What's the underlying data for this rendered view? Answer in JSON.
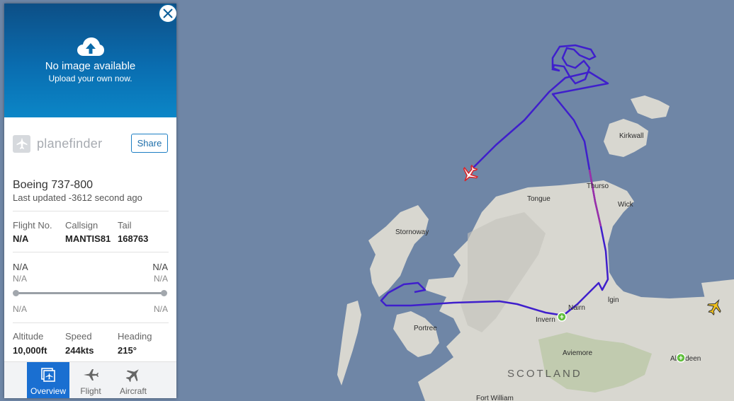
{
  "panel": {
    "photo": {
      "title": "No image available",
      "subtitle": "Upload your own now.",
      "icon": "upload-cloud-icon"
    },
    "close_icon": "close-icon",
    "brand": "planefinder",
    "share_label": "Share",
    "aircraft_type": "Boeing 737-800",
    "last_updated": "Last updated -3612 second ago",
    "flight_labels": {
      "flight_no": "Flight No.",
      "callsign": "Callsign",
      "tail": "Tail"
    },
    "flight_values": {
      "flight_no": "N/A",
      "callsign": "MANTIS81",
      "tail": "168763"
    },
    "route": {
      "origin": "N/A",
      "origin_sub": "N/A",
      "destination": "N/A",
      "destination_sub": "N/A",
      "departure_time": "N/A",
      "arrival_time": "N/A",
      "progress": 1.0
    },
    "stats_labels": {
      "altitude": "Altitude",
      "speed": "Speed",
      "heading": "Heading"
    },
    "stats_values": {
      "altitude": "10,000ft",
      "speed": "244kts",
      "heading": "215°"
    },
    "tabs": [
      {
        "label": "Overview",
        "icon": "overview-icon",
        "active": true
      },
      {
        "label": "Flight",
        "icon": "plane-icon",
        "active": false
      },
      {
        "label": "Aircraft",
        "icon": "aircraft-icon",
        "active": false
      }
    ]
  },
  "map": {
    "labels": {
      "kirkwall": "Kirkwall",
      "thurso": "Thurso",
      "tongue": "Tongue",
      "wick": "Wick",
      "stornoway": "Stornoway",
      "elgin": "lgin",
      "nairn": "Nairn",
      "inverness": "Invern",
      "portree": "Portree",
      "aviemore": "Aviemore",
      "scotland": "SCOTLAND",
      "aberdeen": "Aberdeen",
      "fort_william": "Fort William"
    },
    "colors": {
      "sea": "#6f86a6",
      "land": "#d9d8d2",
      "track": "#3f1fcc",
      "track_accent": "#9b2fa8",
      "aircraft": "#d9262b",
      "other_aircraft": "#f2c21a",
      "airport": "#5fbf3a"
    }
  }
}
